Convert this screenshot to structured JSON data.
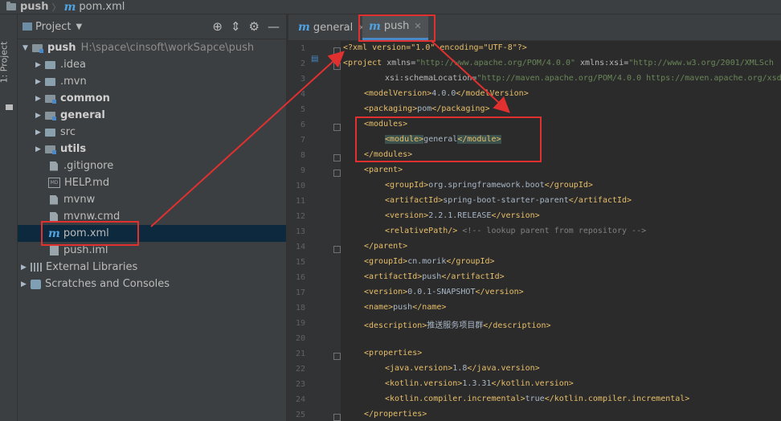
{
  "breadcrumb": {
    "root": "push",
    "file": "pom.xml"
  },
  "stripe": {
    "tab_label": "1: Project"
  },
  "project_panel": {
    "title": "Project",
    "root": {
      "name": "push",
      "path": "H:\\space\\cinsoft\\workSapce\\push"
    },
    "items": [
      {
        "label": ".idea"
      },
      {
        "label": ".mvn"
      },
      {
        "label": "common"
      },
      {
        "label": "general"
      },
      {
        "label": "src"
      },
      {
        "label": "utils"
      },
      {
        "label": ".gitignore"
      },
      {
        "label": "HELP.md"
      },
      {
        "label": "mvnw"
      },
      {
        "label": "mvnw.cmd"
      },
      {
        "label": "pom.xml"
      },
      {
        "label": "push.iml"
      }
    ],
    "external_libraries": "External Libraries",
    "scratches": "Scratches and Consoles"
  },
  "editor": {
    "tabs": [
      {
        "label": "general"
      },
      {
        "label": "push"
      }
    ],
    "line_numbers": [
      "1",
      "2",
      "3",
      "4",
      "5",
      "6",
      "7",
      "8",
      "9",
      "10",
      "11",
      "12",
      "13",
      "14",
      "15",
      "16",
      "17",
      "18",
      "19",
      "20",
      "21",
      "22",
      "23",
      "24",
      "25"
    ],
    "code": {
      "l1a": "<?xml version=\"1.0\" encoding=\"UTF-8\"?>",
      "l2a": "<project ",
      "l2b": "xmlns",
      "l2c": "=",
      "l2d": "\"http://www.apache.org/POM/4.0.0\"",
      "l2e": " xmlns:xsi",
      "l2f": "=",
      "l2g": "\"http://www.w3.org/2001/XMLSch",
      "l3a": "xsi:schemaLocation",
      "l3b": "=",
      "l3c": "\"http://maven.apache.org/POM/4.0.0 https://maven.apache.org/xsd",
      "l4a": "<modelVersion>",
      "l4b": "4.0.0",
      "l4c": "</modelVersion>",
      "l5a": "<packaging>",
      "l5b": "pom",
      "l5c": "</packaging>",
      "l6a": "<modules>",
      "l7a": "<module>",
      "l7b": "general",
      "l7c": "</module>",
      "l8a": "</modules>",
      "l9a": "<parent>",
      "l10a": "<groupId>",
      "l10b": "org.springframework.boot",
      "l10c": "</groupId>",
      "l11a": "<artifactId>",
      "l11b": "spring-boot-starter-parent",
      "l11c": "</artifactId>",
      "l12a": "<version>",
      "l12b": "2.2.1.RELEASE",
      "l12c": "</version>",
      "l13a": "<relativePath/>",
      "l13b": " <!-- lookup parent from repository -->",
      "l14a": "</parent>",
      "l15a": "<groupId>",
      "l15b": "cn.morik",
      "l15c": "</groupId>",
      "l16a": "<artifactId>",
      "l16b": "push",
      "l16c": "</artifactId>",
      "l17a": "<version>",
      "l17b": "0.0.1-SNAPSHOT",
      "l17c": "</version>",
      "l18a": "<name>",
      "l18b": "push",
      "l18c": "</name>",
      "l19a": "<description>",
      "l19b": "推送服务项目群",
      "l19c": "</description>",
      "l21a": "<properties>",
      "l22a": "<java.version>",
      "l22b": "1.8",
      "l22c": "</java.version>",
      "l23a": "<kotlin.version>",
      "l23b": "1.3.31",
      "l23c": "</kotlin.version>",
      "l24a": "<kotlin.compiler.incremental>",
      "l24b": "true",
      "l24c": "</kotlin.compiler.incremental>",
      "l25a": "</properties>"
    }
  },
  "colors": {
    "annotation": "#e03030",
    "tag": "#e8bf6a",
    "attr_value": "#6a8759",
    "selection": "#0d293e"
  }
}
